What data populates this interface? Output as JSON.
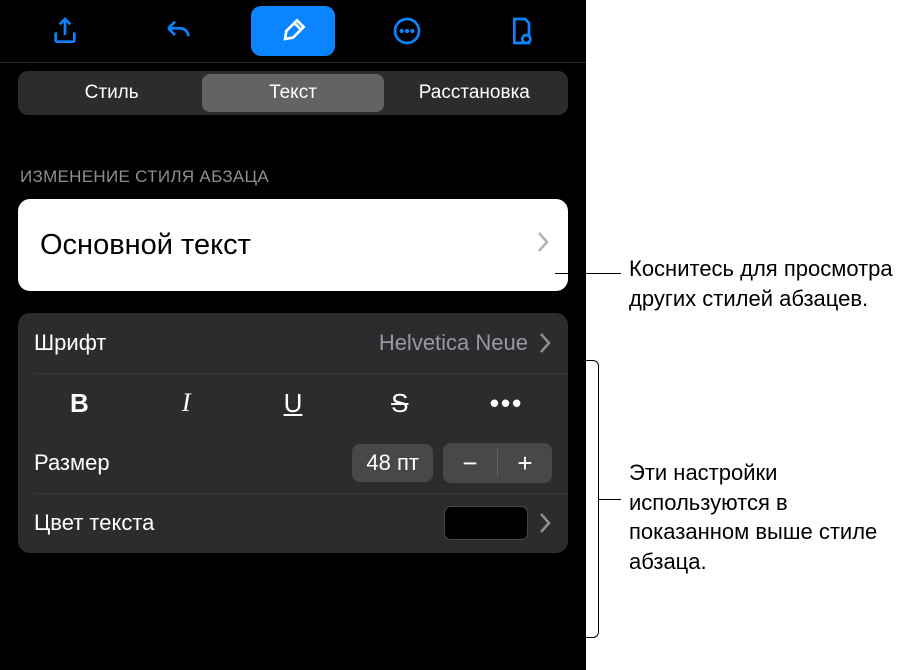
{
  "toolbar": {
    "share_icon": "share-icon",
    "undo_icon": "undo-icon",
    "format_icon": "paintbrush-icon",
    "more_icon": "more-icon",
    "doc_icon": "document-options-icon"
  },
  "tabs": {
    "style": "Стиль",
    "text": "Текст",
    "arrange": "Расстановка"
  },
  "section_label": "ИЗМЕНЕНИЕ СТИЛЯ АБЗАЦА",
  "paragraph_style": "Основной текст",
  "font": {
    "label": "Шрифт",
    "value": "Helvetica Neue"
  },
  "format_buttons": {
    "bold": "B",
    "italic": "I",
    "underline": "U",
    "strike": "S",
    "more": "•••"
  },
  "size": {
    "label": "Размер",
    "value": "48 пт",
    "minus": "−",
    "plus": "+"
  },
  "text_color": {
    "label": "Цвет текста",
    "value": "#000000"
  },
  "callouts": {
    "top": "Коснитесь для просмотра других стилей абзацев.",
    "bottom": "Эти настройки используются в показанном выше стиле абзаца."
  }
}
